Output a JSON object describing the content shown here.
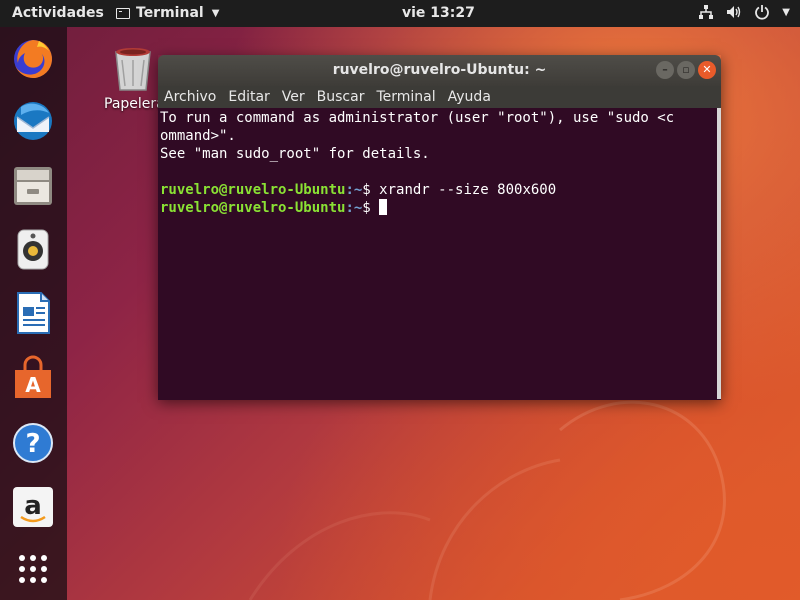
{
  "topbar": {
    "activities": "Actividades",
    "app_menu": "Terminal",
    "clock": "vie 13:27"
  },
  "desktop": {
    "trash_label": "Papelera"
  },
  "dock": {
    "items": [
      "firefox",
      "thunderbird",
      "files",
      "rhythmbox",
      "libreoffice-writer",
      "ubuntu-software",
      "help",
      "amazon",
      "show-applications"
    ]
  },
  "terminal": {
    "title": "ruvelro@ruvelro-Ubuntu: ~",
    "menu": [
      "Archivo",
      "Editar",
      "Ver",
      "Buscar",
      "Terminal",
      "Ayuda"
    ],
    "lines": [
      "To run a command as administrator (user \"root\"), use \"sudo <c",
      "ommand>\".",
      "See \"man sudo_root\" for details."
    ],
    "prompt_user": "ruvelro@ruvelro-Ubuntu",
    "prompt_path": ":~",
    "prompt_symbol": "$",
    "command": " xrandr --size 800x600"
  },
  "colors": {
    "terminal_bg": "#300a24",
    "prompt_user": "#8ae234",
    "prompt_path": "#729fcf",
    "close_button": "#e95b2a",
    "topbar": "#1d1d1d"
  }
}
